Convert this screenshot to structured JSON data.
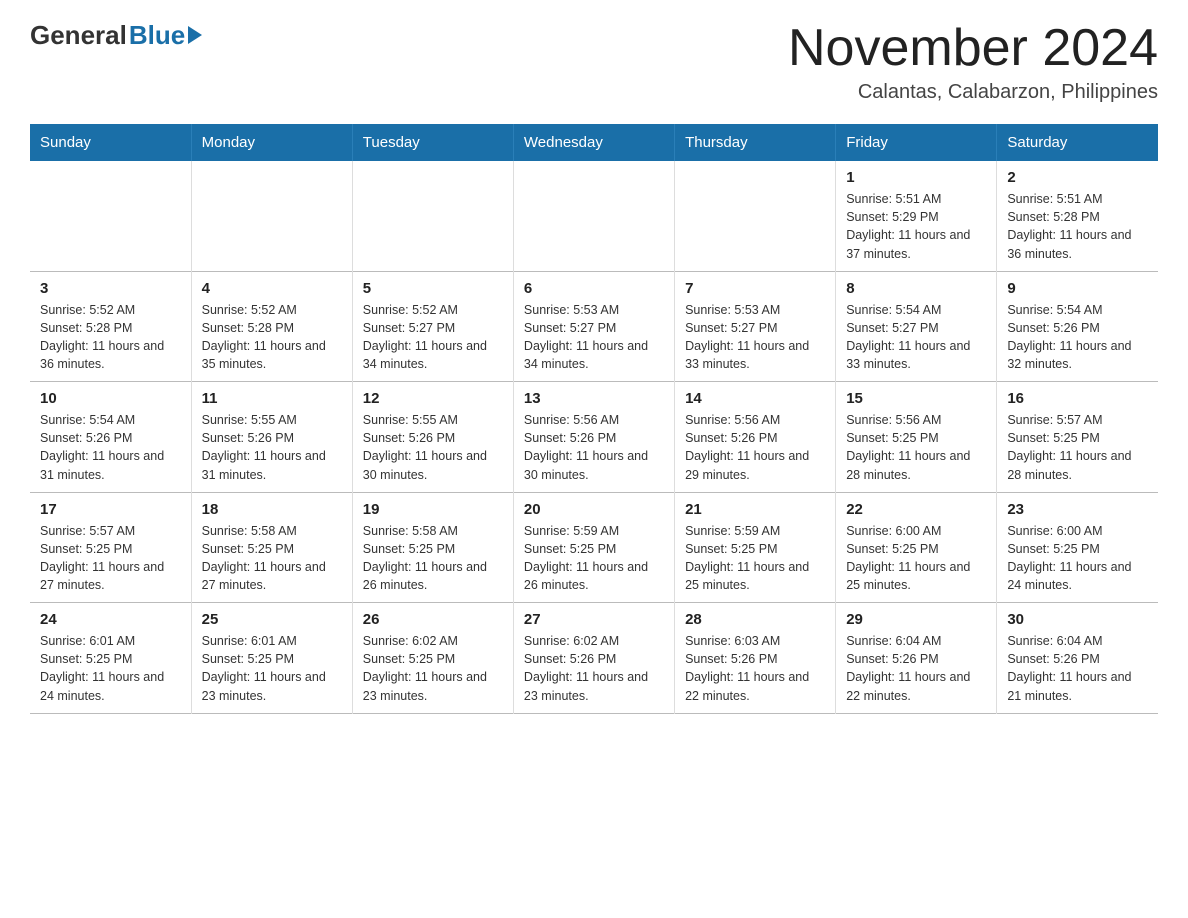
{
  "logo": {
    "general": "General",
    "blue": "Blue"
  },
  "title": "November 2024",
  "subtitle": "Calantas, Calabarzon, Philippines",
  "weekdays": [
    "Sunday",
    "Monday",
    "Tuesday",
    "Wednesday",
    "Thursday",
    "Friday",
    "Saturday"
  ],
  "weeks": [
    [
      {
        "day": "",
        "info": ""
      },
      {
        "day": "",
        "info": ""
      },
      {
        "day": "",
        "info": ""
      },
      {
        "day": "",
        "info": ""
      },
      {
        "day": "",
        "info": ""
      },
      {
        "day": "1",
        "info": "Sunrise: 5:51 AM\nSunset: 5:29 PM\nDaylight: 11 hours and 37 minutes."
      },
      {
        "day": "2",
        "info": "Sunrise: 5:51 AM\nSunset: 5:28 PM\nDaylight: 11 hours and 36 minutes."
      }
    ],
    [
      {
        "day": "3",
        "info": "Sunrise: 5:52 AM\nSunset: 5:28 PM\nDaylight: 11 hours and 36 minutes."
      },
      {
        "day": "4",
        "info": "Sunrise: 5:52 AM\nSunset: 5:28 PM\nDaylight: 11 hours and 35 minutes."
      },
      {
        "day": "5",
        "info": "Sunrise: 5:52 AM\nSunset: 5:27 PM\nDaylight: 11 hours and 34 minutes."
      },
      {
        "day": "6",
        "info": "Sunrise: 5:53 AM\nSunset: 5:27 PM\nDaylight: 11 hours and 34 minutes."
      },
      {
        "day": "7",
        "info": "Sunrise: 5:53 AM\nSunset: 5:27 PM\nDaylight: 11 hours and 33 minutes."
      },
      {
        "day": "8",
        "info": "Sunrise: 5:54 AM\nSunset: 5:27 PM\nDaylight: 11 hours and 33 minutes."
      },
      {
        "day": "9",
        "info": "Sunrise: 5:54 AM\nSunset: 5:26 PM\nDaylight: 11 hours and 32 minutes."
      }
    ],
    [
      {
        "day": "10",
        "info": "Sunrise: 5:54 AM\nSunset: 5:26 PM\nDaylight: 11 hours and 31 minutes."
      },
      {
        "day": "11",
        "info": "Sunrise: 5:55 AM\nSunset: 5:26 PM\nDaylight: 11 hours and 31 minutes."
      },
      {
        "day": "12",
        "info": "Sunrise: 5:55 AM\nSunset: 5:26 PM\nDaylight: 11 hours and 30 minutes."
      },
      {
        "day": "13",
        "info": "Sunrise: 5:56 AM\nSunset: 5:26 PM\nDaylight: 11 hours and 30 minutes."
      },
      {
        "day": "14",
        "info": "Sunrise: 5:56 AM\nSunset: 5:26 PM\nDaylight: 11 hours and 29 minutes."
      },
      {
        "day": "15",
        "info": "Sunrise: 5:56 AM\nSunset: 5:25 PM\nDaylight: 11 hours and 28 minutes."
      },
      {
        "day": "16",
        "info": "Sunrise: 5:57 AM\nSunset: 5:25 PM\nDaylight: 11 hours and 28 minutes."
      }
    ],
    [
      {
        "day": "17",
        "info": "Sunrise: 5:57 AM\nSunset: 5:25 PM\nDaylight: 11 hours and 27 minutes."
      },
      {
        "day": "18",
        "info": "Sunrise: 5:58 AM\nSunset: 5:25 PM\nDaylight: 11 hours and 27 minutes."
      },
      {
        "day": "19",
        "info": "Sunrise: 5:58 AM\nSunset: 5:25 PM\nDaylight: 11 hours and 26 minutes."
      },
      {
        "day": "20",
        "info": "Sunrise: 5:59 AM\nSunset: 5:25 PM\nDaylight: 11 hours and 26 minutes."
      },
      {
        "day": "21",
        "info": "Sunrise: 5:59 AM\nSunset: 5:25 PM\nDaylight: 11 hours and 25 minutes."
      },
      {
        "day": "22",
        "info": "Sunrise: 6:00 AM\nSunset: 5:25 PM\nDaylight: 11 hours and 25 minutes."
      },
      {
        "day": "23",
        "info": "Sunrise: 6:00 AM\nSunset: 5:25 PM\nDaylight: 11 hours and 24 minutes."
      }
    ],
    [
      {
        "day": "24",
        "info": "Sunrise: 6:01 AM\nSunset: 5:25 PM\nDaylight: 11 hours and 24 minutes."
      },
      {
        "day": "25",
        "info": "Sunrise: 6:01 AM\nSunset: 5:25 PM\nDaylight: 11 hours and 23 minutes."
      },
      {
        "day": "26",
        "info": "Sunrise: 6:02 AM\nSunset: 5:25 PM\nDaylight: 11 hours and 23 minutes."
      },
      {
        "day": "27",
        "info": "Sunrise: 6:02 AM\nSunset: 5:26 PM\nDaylight: 11 hours and 23 minutes."
      },
      {
        "day": "28",
        "info": "Sunrise: 6:03 AM\nSunset: 5:26 PM\nDaylight: 11 hours and 22 minutes."
      },
      {
        "day": "29",
        "info": "Sunrise: 6:04 AM\nSunset: 5:26 PM\nDaylight: 11 hours and 22 minutes."
      },
      {
        "day": "30",
        "info": "Sunrise: 6:04 AM\nSunset: 5:26 PM\nDaylight: 11 hours and 21 minutes."
      }
    ]
  ]
}
